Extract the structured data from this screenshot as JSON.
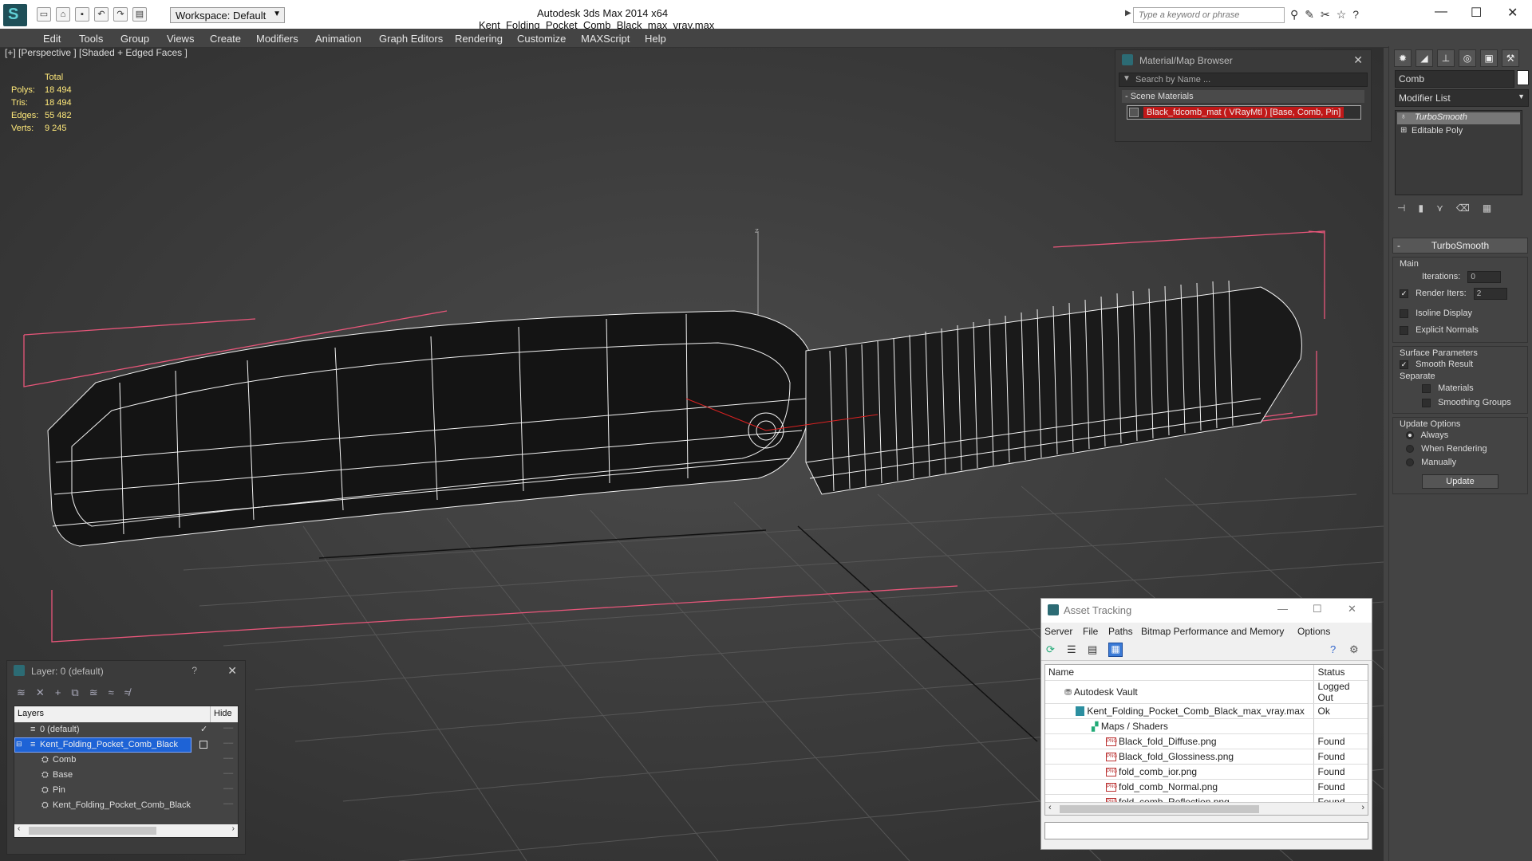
{
  "titlebar": {
    "workspace": "Workspace: Default",
    "app_title": "Autodesk 3ds Max  2014 x64",
    "file_title": "Kent_Folding_Pocket_Comb_Black_max_vray.max",
    "search_placeholder": "Type a keyword or phrase"
  },
  "menu": {
    "items": [
      "Edit",
      "Tools",
      "Group",
      "Views",
      "Create",
      "Modifiers",
      "Animation",
      "Graph Editors",
      "Rendering",
      "Customize",
      "MAXScript",
      "Help"
    ]
  },
  "viewport": {
    "label": "[+] [Perspective ] [Shaded + Edged Faces ]",
    "stats": {
      "header": "Total",
      "polys_label": "Polys:",
      "polys": "18 494",
      "tris_label": "Tris:",
      "tris": "18 494",
      "edges_label": "Edges:",
      "edges": "55 482",
      "verts_label": "Verts:",
      "verts": "9 245"
    },
    "axis_label": "z"
  },
  "material_browser": {
    "title": "Material/Map Browser",
    "search_placeholder": "Search by Name ...",
    "section": "- Scene Materials",
    "material": "Black_fdcomb_mat  ( VRayMtl )  [Base, Comb, Pin]"
  },
  "command_panel": {
    "object_name": "Comb",
    "modifier_list": "Modifier List",
    "stack": [
      "TurboSmooth",
      "Editable Poly"
    ],
    "rollout_title": "TurboSmooth",
    "main_label": "Main",
    "iterations_label": "Iterations:",
    "iterations_value": "0",
    "render_iters_label": "Render Iters:",
    "render_iters_value": "2",
    "isoline": "Isoline Display",
    "explicit_normals": "Explicit Normals",
    "surface_params": "Surface Parameters",
    "smooth_result": "Smooth Result",
    "separate": "Separate",
    "materials": "Materials",
    "smoothing_groups": "Smoothing Groups",
    "update_options": "Update Options",
    "always": "Always",
    "when_rendering": "When Rendering",
    "manually": "Manually",
    "update_button": "Update"
  },
  "layer_panel": {
    "title": "Layer: 0 (default)",
    "help": "?",
    "col_layers": "Layers",
    "col_hide": "Hide",
    "rows": [
      {
        "name": "0 (default)",
        "level": 0
      },
      {
        "name": "Kent_Folding_Pocket_Comb_Black",
        "level": 0,
        "selected": true
      },
      {
        "name": "Comb",
        "level": 1
      },
      {
        "name": "Base",
        "level": 1
      },
      {
        "name": "Pin",
        "level": 1
      },
      {
        "name": "Kent_Folding_Pocket_Comb_Black",
        "level": 1
      }
    ]
  },
  "asset_tracking": {
    "title": "Asset Tracking",
    "menu": [
      "Server",
      "File",
      "Paths",
      "Bitmap Performance and Memory",
      "Options"
    ],
    "col_name": "Name",
    "col_status": "Status",
    "rows": [
      {
        "name": "Autodesk Vault",
        "status": "Logged Out",
        "indent": 1,
        "icon": "vault"
      },
      {
        "name": "Kent_Folding_Pocket_Comb_Black_max_vray.max",
        "status": "Ok",
        "indent": 2,
        "icon": "max"
      },
      {
        "name": "Maps / Shaders",
        "status": "",
        "indent": 3,
        "icon": "maps"
      },
      {
        "name": "Black_fold_Diffuse.png",
        "status": "Found",
        "indent": 4,
        "icon": "png"
      },
      {
        "name": "Black_fold_Glossiness.png",
        "status": "Found",
        "indent": 4,
        "icon": "png"
      },
      {
        "name": "fold_comb_ior.png",
        "status": "Found",
        "indent": 4,
        "icon": "png"
      },
      {
        "name": "fold_comb_Normal.png",
        "status": "Found",
        "indent": 4,
        "icon": "png"
      },
      {
        "name": "fold_comb_Reflection.png",
        "status": "Found",
        "indent": 4,
        "icon": "png"
      }
    ]
  },
  "colors": {
    "accent_selected": "#1e63d6",
    "material_highlight": "#c01818",
    "stats_text": "#ffe97a",
    "bbox_pink": "#e8567a"
  }
}
